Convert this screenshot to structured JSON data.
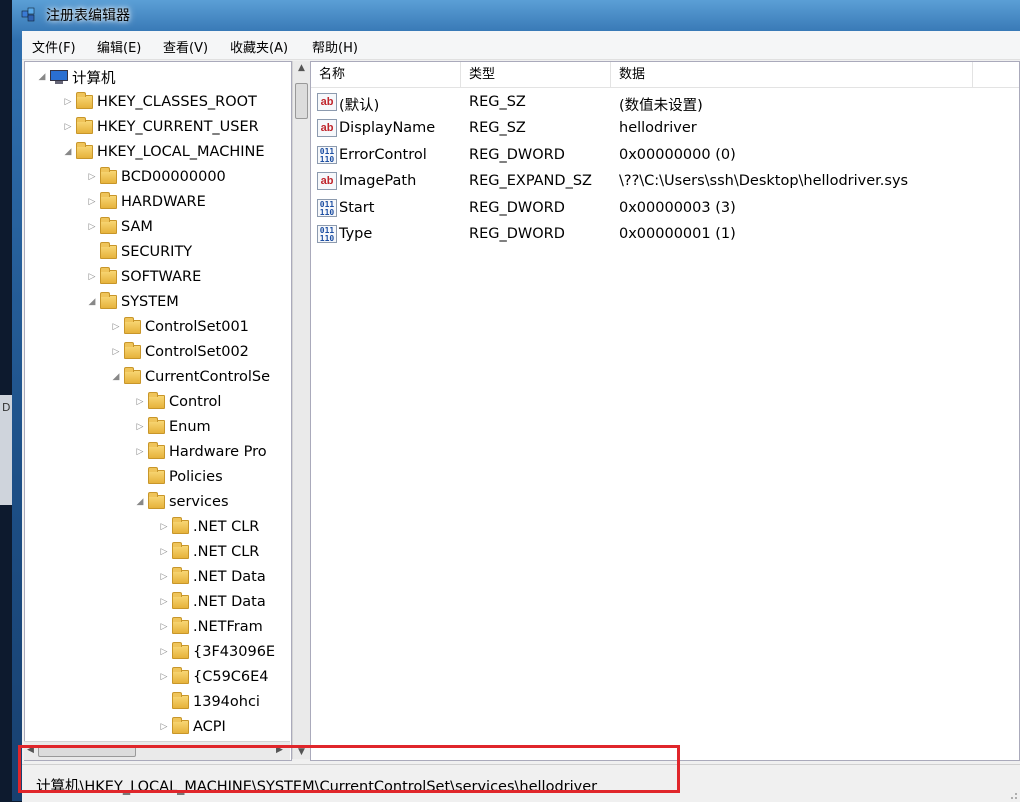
{
  "window": {
    "title": "注册表编辑器"
  },
  "menu": [
    "文件(F)",
    "编辑(E)",
    "查看(V)",
    "收藏夹(A)",
    "帮助(H)"
  ],
  "tree": [
    {
      "label": "计算机",
      "expander": "◢",
      "icon": "computer-icon"
    },
    {
      "label": "HKEY_CLASSES_ROOT",
      "expander": "▷",
      "icon": "folder-icon"
    },
    {
      "label": "HKEY_CURRENT_USER",
      "expander": "▷",
      "icon": "folder-icon"
    },
    {
      "label": "HKEY_LOCAL_MACHINE",
      "expander": "◢",
      "icon": "folder-icon"
    },
    {
      "label": "BCD00000000",
      "expander": "▷",
      "icon": "folder-icon"
    },
    {
      "label": "HARDWARE",
      "expander": "▷",
      "icon": "folder-icon"
    },
    {
      "label": "SAM",
      "expander": "▷",
      "icon": "folder-icon"
    },
    {
      "label": "SECURITY",
      "expander": "",
      "icon": "folder-icon"
    },
    {
      "label": "SOFTWARE",
      "expander": "▷",
      "icon": "folder-icon"
    },
    {
      "label": "SYSTEM",
      "expander": "◢",
      "icon": "folder-icon"
    },
    {
      "label": "ControlSet001",
      "expander": "▷",
      "icon": "folder-icon"
    },
    {
      "label": "ControlSet002",
      "expander": "▷",
      "icon": "folder-icon"
    },
    {
      "label": "CurrentControlSe",
      "expander": "◢",
      "icon": "folder-icon"
    },
    {
      "label": "Control",
      "expander": "▷",
      "icon": "folder-icon"
    },
    {
      "label": "Enum",
      "expander": "▷",
      "icon": "folder-icon"
    },
    {
      "label": "Hardware Pro",
      "expander": "▷",
      "icon": "folder-icon"
    },
    {
      "label": "Policies",
      "expander": "",
      "icon": "folder-icon"
    },
    {
      "label": "services",
      "expander": "◢",
      "icon": "folder-icon"
    },
    {
      "label": ".NET CLR",
      "expander": "▷",
      "icon": "folder-icon"
    },
    {
      "label": ".NET CLR",
      "expander": "▷",
      "icon": "folder-icon"
    },
    {
      "label": ".NET Data",
      "expander": "▷",
      "icon": "folder-icon"
    },
    {
      "label": ".NET Data",
      "expander": "▷",
      "icon": "folder-icon"
    },
    {
      "label": ".NETFram",
      "expander": "▷",
      "icon": "folder-icon"
    },
    {
      "label": "{3F43096E",
      "expander": "▷",
      "icon": "folder-icon"
    },
    {
      "label": "{C59C6E4",
      "expander": "▷",
      "icon": "folder-icon"
    },
    {
      "label": "1394ohci",
      "expander": "",
      "icon": "folder-icon"
    },
    {
      "label": "ACPI",
      "expander": "▷",
      "icon": "folder-icon"
    }
  ],
  "list": {
    "headers": [
      "名称",
      "类型",
      "数据"
    ],
    "rows": [
      {
        "name": "(默认)",
        "type": "REG_SZ",
        "data": "(数值未设置)",
        "icon": "string-value-icon",
        "glyph": "ab"
      },
      {
        "name": "DisplayName",
        "type": "REG_SZ",
        "data": "hellodriver",
        "icon": "string-value-icon",
        "glyph": "ab"
      },
      {
        "name": "ErrorControl",
        "type": "REG_DWORD",
        "data": "0x00000000 (0)",
        "icon": "dword-value-icon",
        "glyph": "011 110"
      },
      {
        "name": "ImagePath",
        "type": "REG_EXPAND_SZ",
        "data": "\\??\\C:\\Users\\ssh\\Desktop\\hellodriver.sys",
        "icon": "string-value-icon",
        "glyph": "ab"
      },
      {
        "name": "Start",
        "type": "REG_DWORD",
        "data": "0x00000003 (3)",
        "icon": "dword-value-icon",
        "glyph": "011 110"
      },
      {
        "name": "Type",
        "type": "REG_DWORD",
        "data": "0x00000001 (1)",
        "icon": "dword-value-icon",
        "glyph": "011 110"
      }
    ]
  },
  "status": {
    "path": "计算机\\HKEY_LOCAL_MACHINE\\SYSTEM\\CurrentControlSet\\services\\hellodriver"
  },
  "background": {
    "fragment": "D"
  },
  "colors": {
    "highlight": "#e0262b",
    "titlebar": "#2f6fae"
  }
}
